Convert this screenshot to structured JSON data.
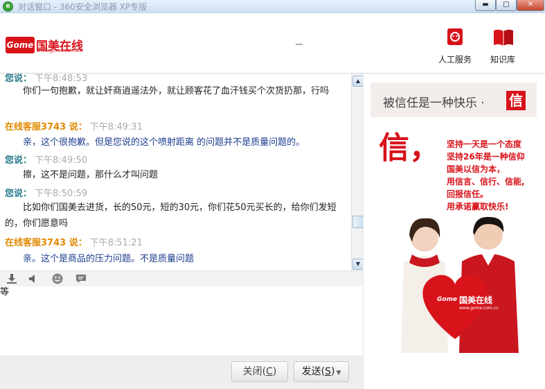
{
  "window": {
    "title": "对话窗口 - 360安全浏览器 XP专版",
    "app_icon_glyph": "e",
    "min_glyph": "▬",
    "max_glyph": "□",
    "close_glyph": "✕"
  },
  "header": {
    "logo": {
      "badge": "Gome",
      "name": "国美在线",
      "url": "www.gome.com.cn"
    },
    "toolbar": [
      {
        "label": "人工服务",
        "icon": "headset-icon"
      },
      {
        "label": "知识库",
        "icon": "book-icon"
      }
    ]
  },
  "messages": [
    {
      "sender": "您说：",
      "time": "下午8:48:53",
      "text": "你们一句抱歉，就让奸商逍遥法外，就让顾客花了血汗钱买个次货扔那，行吗",
      "role": "me"
    },
    {
      "sender": "在线客服3743 说：",
      "time": "下午8:49:31",
      "text": "亲，这个很抱歉。但是您说的这个喷射距离 的问题并不是质量问题的。",
      "role": "agent"
    },
    {
      "sender": "您说：",
      "time": "下午8:49:50",
      "text": "擦，这不是问题，那什么才叫问题",
      "role": "me"
    },
    {
      "sender": "您说：",
      "time": "下午8:50:59",
      "text": "比如你们国美去进货，长的50元，短的30元，你们花50元买长的，给你们发短的，你们愿意吗",
      "role": "me"
    },
    {
      "sender": "在线客服3743 说：",
      "time": "下午8:51:21",
      "text": "亲。这个是商品的压力问题。不是质量问题",
      "role": "agent"
    }
  ],
  "input_toolbar": [
    "download-icon",
    "sound-icon",
    "emoji-icon",
    "chat-bubble-icon"
  ],
  "input": {
    "value": "等"
  },
  "footer": {
    "close_label": "关闭",
    "close_key": "C",
    "send_label": "发送",
    "send_key": "S"
  },
  "ad": {
    "slogan": "被信任是一种快乐 ·",
    "slogan_mark": "信",
    "big_text": "信，",
    "lines": [
      "坚持一天是一个态度",
      "坚持26年是一种信仰",
      "国美以信为本，",
      "用信言、信行、信能,",
      "回报信任。",
      "用承诺赢取快乐!"
    ],
    "heart_logo": "国美在线",
    "heart_badge": "Gome",
    "heart_url": "www.gome.com.cn"
  },
  "colors": {
    "brand_red": "#d8131a",
    "agent_name": "#e08a00",
    "me_name": "#2a7d8c",
    "agent_text": "#1d3d8f"
  }
}
